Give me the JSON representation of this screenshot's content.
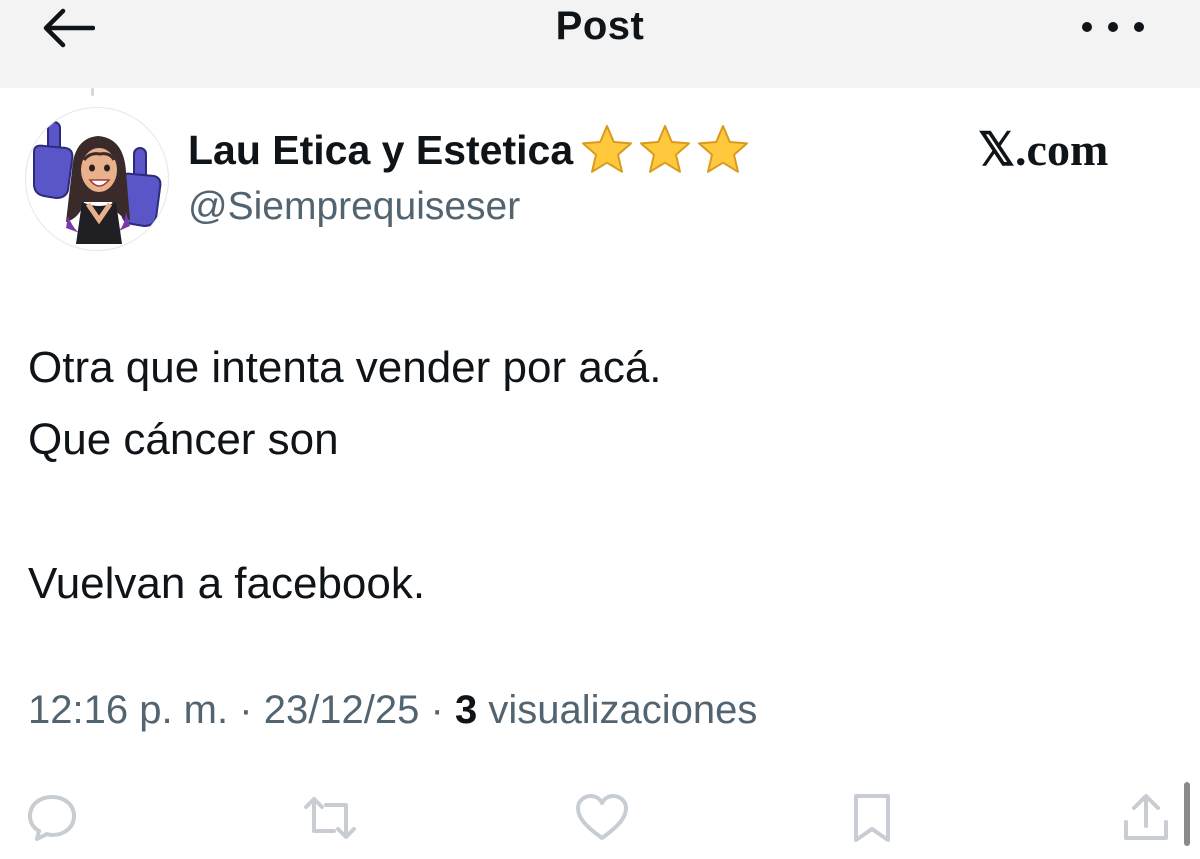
{
  "header": {
    "title": "Post",
    "back_icon": "arrow-left-icon",
    "more_icon": "more-horizontal-icon"
  },
  "author": {
    "display_name": "Lau Etica y Estetica",
    "stars_count": 3,
    "handle": "@Siemprequiseser",
    "avatar": "bitmoji-avatar"
  },
  "watermark": "𝕏.com",
  "post": {
    "text": "Otra que intenta vender por acá.\nQue cáncer son\n\nVuelvan a facebook."
  },
  "meta": {
    "time": "12:16 p. m.",
    "separator": "·",
    "date": "23/12/25",
    "views_count": "3",
    "views_label": "visualizaciones"
  },
  "actions": [
    {
      "name": "reply",
      "icon": "comment-icon"
    },
    {
      "name": "repost",
      "icon": "repost-icon"
    },
    {
      "name": "like",
      "icon": "heart-icon"
    },
    {
      "name": "bookmark",
      "icon": "bookmark-icon"
    },
    {
      "name": "share",
      "icon": "share-icon"
    }
  ],
  "colors": {
    "text": "#0f1419",
    "secondary": "#536471",
    "action_icons": "#c7cdd2",
    "header_bg": "#f3f3f3",
    "star": "#ffc83d"
  }
}
